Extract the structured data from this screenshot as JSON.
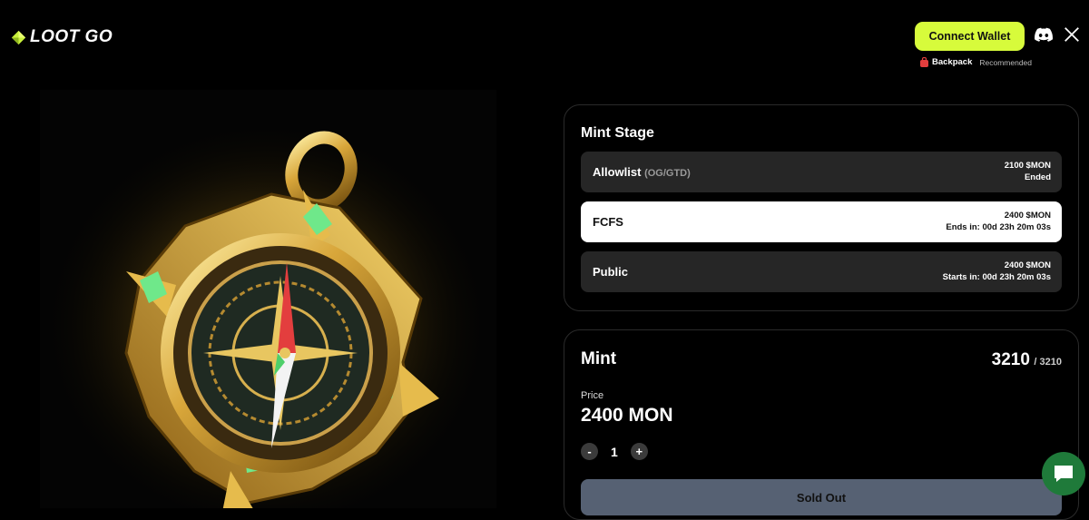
{
  "header": {
    "logo_text": "LOOT GO",
    "connect_label": "Connect Wallet",
    "backpack_name": "Backpack",
    "backpack_tag": "Recommended"
  },
  "icons": [
    "diamond-logo-icon",
    "discord-icon",
    "x-icon",
    "backpack-icon",
    "chat-icon"
  ],
  "colors": {
    "accent": "#d7fb3b",
    "soldout": "#566173",
    "chat": "#1f7a3a"
  },
  "stage": {
    "title": "Mint Stage",
    "rows": [
      {
        "name": "Allowlist",
        "sub": "(OG/GTD)",
        "price": "2100 $MON",
        "status": "Ended"
      },
      {
        "name": "FCFS",
        "sub": "",
        "price": "2400 $MON",
        "status": "Ends in: 00d 23h 20m 03s"
      },
      {
        "name": "Public",
        "sub": "",
        "price": "2400 $MON",
        "status": "Starts in: 00d 23h 20m 03s"
      }
    ]
  },
  "mint": {
    "title": "Mint",
    "minted": "3210",
    "total": "/ 3210",
    "price_label": "Price",
    "price": "2400 MON",
    "qty_minus": "-",
    "qty": "1",
    "qty_plus": "+",
    "button": "Sold Out"
  }
}
